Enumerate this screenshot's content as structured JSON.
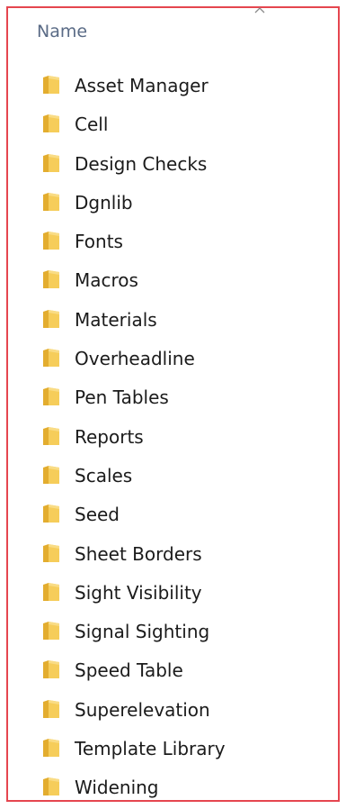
{
  "header": {
    "name_label": "Name"
  },
  "colors": {
    "frame_border": "#e5464f",
    "folder_yellow": "#f6cd5a",
    "header_text": "#5a6b86"
  },
  "folders": [
    {
      "name": "Asset Manager"
    },
    {
      "name": "Cell"
    },
    {
      "name": "Design Checks"
    },
    {
      "name": "Dgnlib"
    },
    {
      "name": "Fonts"
    },
    {
      "name": "Macros"
    },
    {
      "name": "Materials"
    },
    {
      "name": "Overheadline"
    },
    {
      "name": "Pen Tables"
    },
    {
      "name": "Reports"
    },
    {
      "name": "Scales"
    },
    {
      "name": "Seed"
    },
    {
      "name": "Sheet Borders"
    },
    {
      "name": "Sight Visibility"
    },
    {
      "name": "Signal Sighting"
    },
    {
      "name": "Speed Table"
    },
    {
      "name": "Superelevation"
    },
    {
      "name": "Template Library"
    },
    {
      "name": "Widening"
    }
  ]
}
